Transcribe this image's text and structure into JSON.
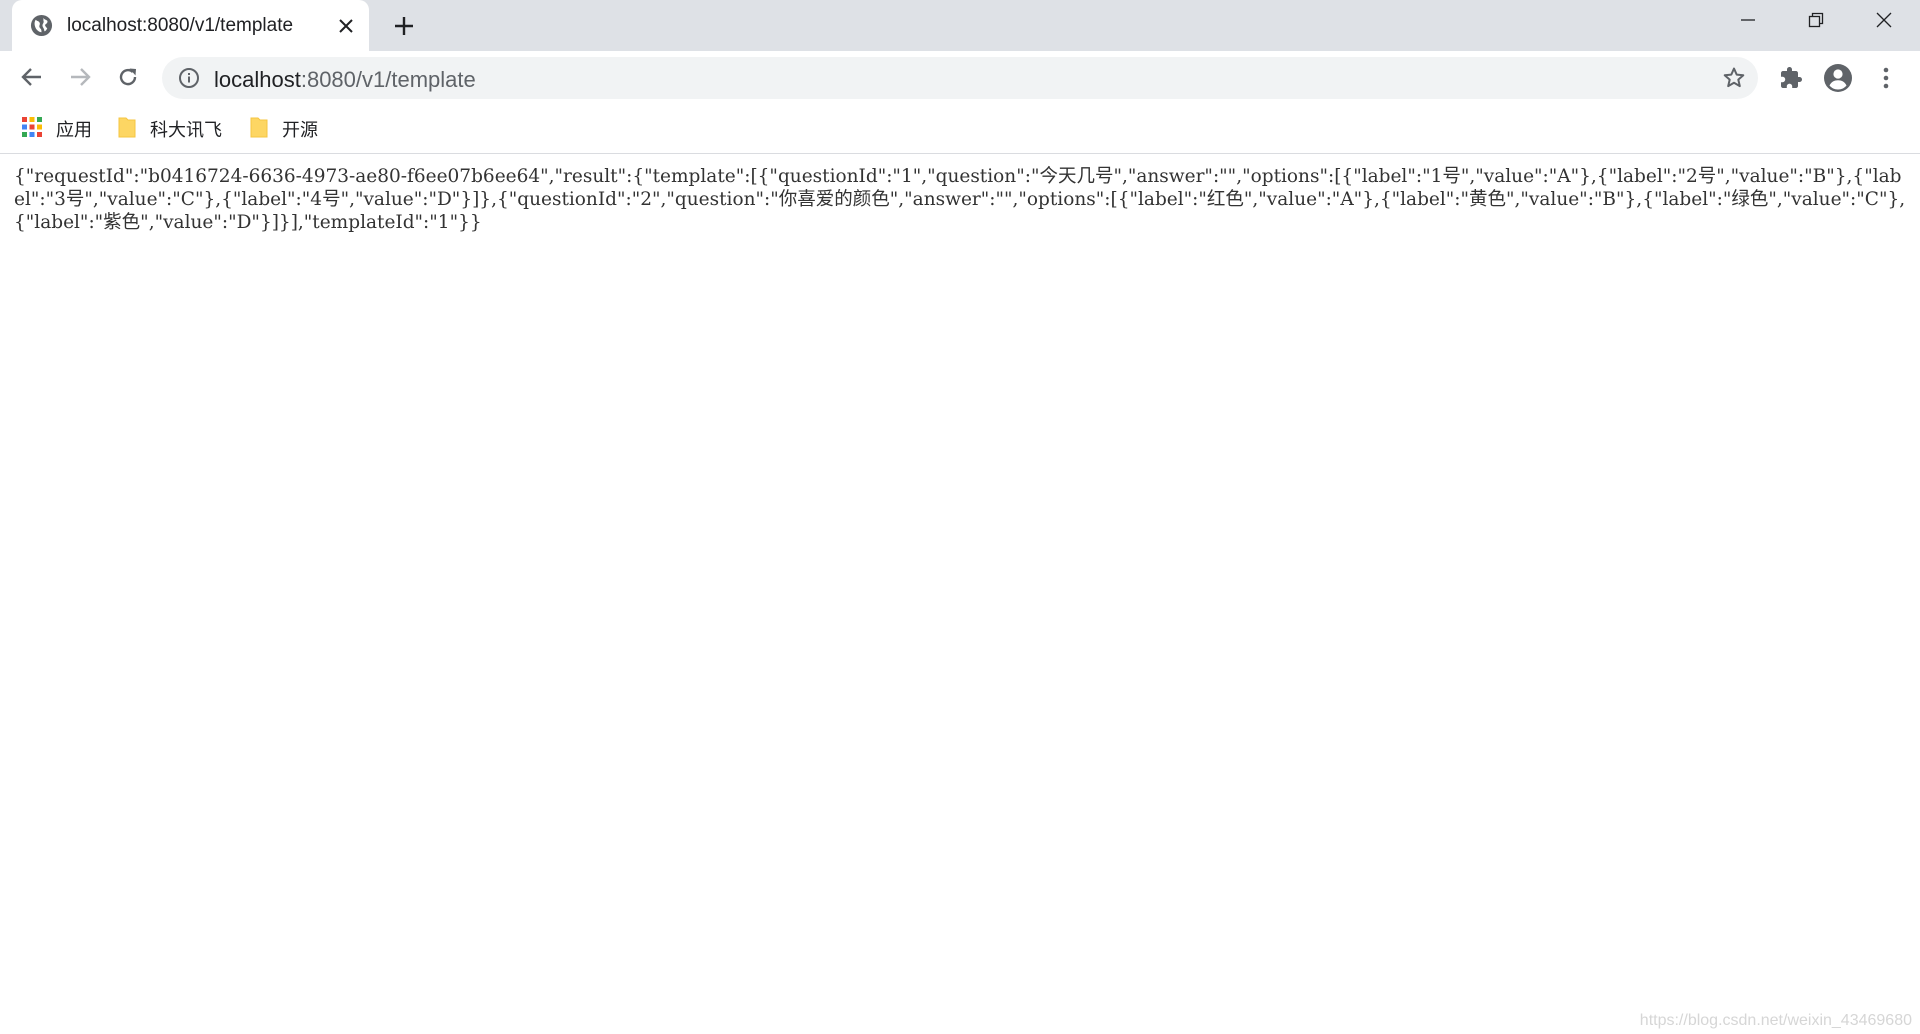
{
  "tab": {
    "title": "localhost:8080/v1/template",
    "favicon": "globe-icon"
  },
  "window_controls": [
    "minimize-icon",
    "restore-icon",
    "close-icon"
  ],
  "toolbar": {
    "icons": [
      "back-arrow-icon",
      "forward-arrow-icon",
      "reload-icon",
      "extensions-icon",
      "profile-icon",
      "menu-icon"
    ]
  },
  "omnibox": {
    "host": "localhost",
    "path": ":8080/v1/template",
    "icons": [
      "info-icon",
      "star-icon"
    ]
  },
  "bookmarks": [
    {
      "label": "应用",
      "icon": "apps-grid-icon"
    },
    {
      "label": "科大讯飞",
      "icon": "folder-icon"
    },
    {
      "label": "开源",
      "icon": "folder-icon"
    }
  ],
  "page": {
    "raw_json": "{\"requestId\":\"b0416724-6636-4973-ae80-f6ee07b6ee64\",\"result\":{\"template\":[{\"questionId\":\"1\",\"question\":\"今天几号\",\"answer\":\"\",\"options\":[{\"label\":\"1号\",\"value\":\"A\"},{\"label\":\"2号\",\"value\":\"B\"},{\"label\":\"3号\",\"value\":\"C\"},{\"label\":\"4号\",\"value\":\"D\"}]},{\"questionId\":\"2\",\"question\":\"你喜爱的颜色\",\"answer\":\"\",\"options\":[{\"label\":\"红色\",\"value\":\"A\"},{\"label\":\"黄色\",\"value\":\"B\"},{\"label\":\"绿色\",\"value\":\"C\"},{\"label\":\"紫色\",\"value\":\"D\"}]}],\"templateId\":\"1\"}}",
    "watermark": "https://blog.csdn.net/weixin_43469680"
  },
  "colors": {
    "tabstrip_bg": "#dee1e6",
    "omnibox_bg": "#f1f3f4",
    "icon": "#5f6368",
    "folder": "#fdd663"
  }
}
